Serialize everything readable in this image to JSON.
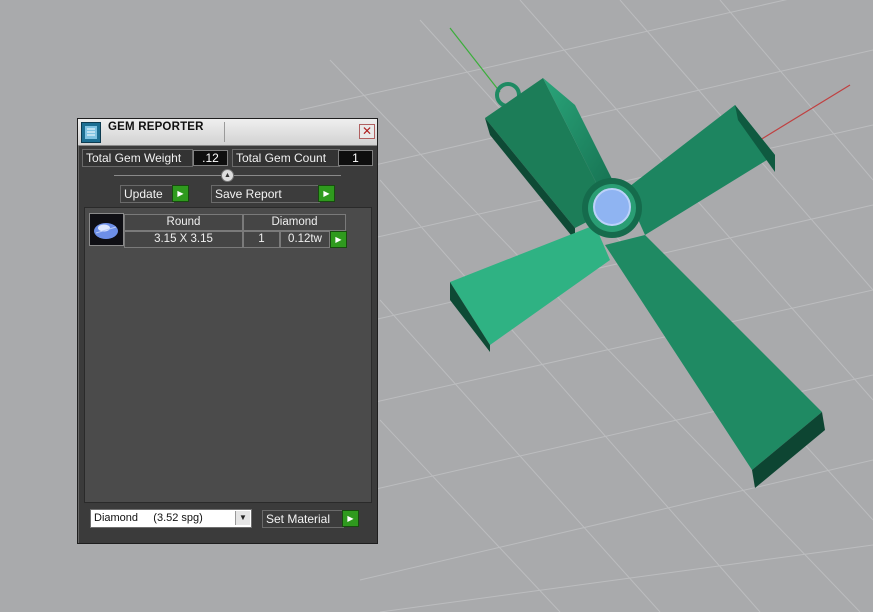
{
  "panel": {
    "title": "GEM REPORTER",
    "close_glyph": "✕",
    "total_gem_weight_label": "Total Gem Weight",
    "total_gem_weight_value": ".12",
    "total_gem_count_label": "Total Gem Count",
    "total_gem_count_value": "1",
    "update_label": "Update",
    "save_report_label": "Save Report",
    "go_glyph": "▶",
    "collapse_glyph": "▲",
    "gems": [
      {
        "shape": "Round",
        "material": "Diamond",
        "size": "3.15 X 3.15",
        "count": "1",
        "weight": "0.12tw"
      }
    ],
    "material_select_value": "Diamond     (3.52 spg)",
    "select_arrow": "▼",
    "set_material_label": "Set Material"
  },
  "icons": {
    "title_icon": "gem-reporter-icon",
    "gem_thumbnail": "round-diamond-icon",
    "close": "close-icon"
  },
  "colors": {
    "viewport_bg": "#a9aaac",
    "grid": "#bfc0c2",
    "pendant": "#1f8a63",
    "gem": "#8fb4f2",
    "accent_green": "#2f9a1e"
  }
}
